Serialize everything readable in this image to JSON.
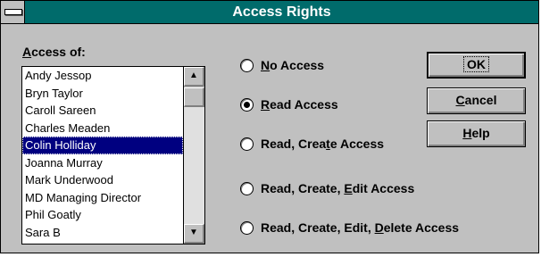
{
  "window": {
    "title": "Access Rights"
  },
  "access_of": {
    "label": "Access of:"
  },
  "users": [
    "Andy Jessop",
    "Bryn Taylor",
    "Caroll Sareen",
    "Charles Meaden",
    "Colin Holliday",
    "Joanna Murray",
    "Mark Underwood",
    "MD Managing Director",
    "Phil Goatly",
    "Sara B"
  ],
  "selected_user": "Colin Holliday",
  "access_options": [
    {
      "label": "No Access",
      "checked": false
    },
    {
      "label": "Read Access",
      "checked": true
    },
    {
      "label": "Read, Create Access",
      "checked": false
    },
    {
      "label": "Read, Create, Edit Access",
      "checked": false
    },
    {
      "label": "Read, Create, Edit, Delete Access",
      "checked": false
    }
  ],
  "buttons": {
    "ok": "OK",
    "cancel": "Cancel",
    "help": "Help"
  }
}
